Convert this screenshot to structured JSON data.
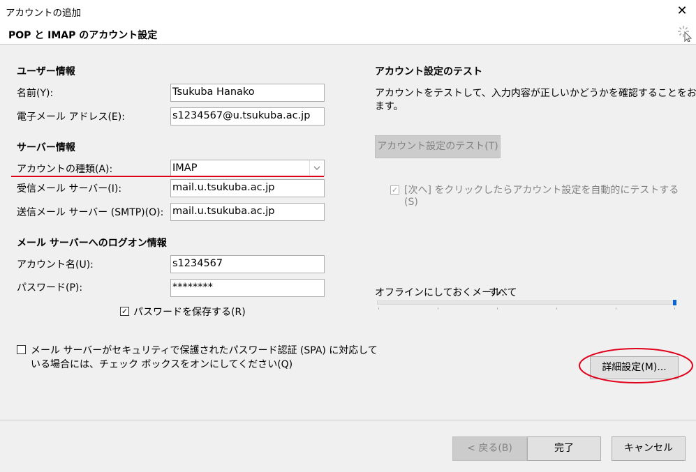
{
  "window": {
    "title": "アカウントの追加",
    "close_symbol": "✕"
  },
  "page": {
    "title": "POP と IMAP のアカウント設定"
  },
  "user_info": {
    "heading": "ユーザー情報",
    "name_label": "名前(Y):",
    "name_value": "Tsukuba Hanako",
    "email_label": "電子メール アドレス(E):",
    "email_value": "s1234567@u.tsukuba.ac.jp"
  },
  "server_info": {
    "heading": "サーバー情報",
    "account_type_label": "アカウントの種類(A):",
    "account_type_value": "IMAP",
    "incoming_label": "受信メール サーバー(I):",
    "incoming_value": "mail.u.tsukuba.ac.jp",
    "outgoing_label": "送信メール サーバー (SMTP)(O):",
    "outgoing_value": "mail.u.tsukuba.ac.jp"
  },
  "logon_info": {
    "heading": "メール サーバーへのログオン情報",
    "account_name_label": "アカウント名(U):",
    "account_name_value": "s1234567",
    "password_label": "パスワード(P):",
    "password_value": "********",
    "save_password_label": "パスワードを保存する(R)",
    "save_password_checked": true
  },
  "spa": {
    "line1": "メール サーバーがセキュリティで保護されたパスワード認証 (SPA) に対応して",
    "line2": "いる場合には、チェック ボックスをオンにしてください(Q)",
    "checked": false
  },
  "test_settings": {
    "heading": "アカウント設定のテスト",
    "desc_line1": "アカウントをテストして、入力内容が正しいかどうかを確認することをお勧めし",
    "desc_line2": "ます。",
    "test_button": "アカウント設定のテスト(T)",
    "auto_test_line1": "[次へ] をクリックしたらアカウント設定を自動的にテストする",
    "auto_test_line2": "(S)",
    "auto_test_checked": true
  },
  "offline": {
    "label": "オフラインにしておくメール:",
    "value": "すべて",
    "slider_fraction": 1.0
  },
  "more_settings_button": "詳細設定(M)...",
  "footer": {
    "back": "< 戻る(B)",
    "finish": "完了",
    "cancel": "キャンセル"
  },
  "colors": {
    "annotation_red": "#e0001a",
    "slider_thumb": "#0a64d4"
  }
}
